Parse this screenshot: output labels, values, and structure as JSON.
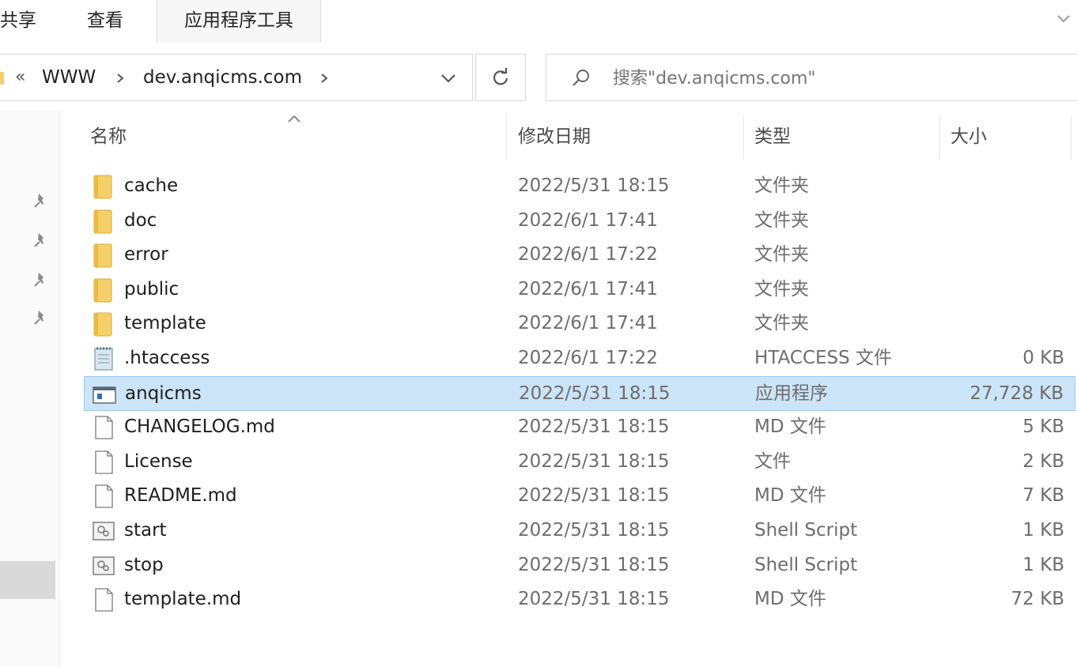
{
  "ribbon": {
    "tabs": [
      {
        "label": "共享"
      },
      {
        "label": "查看"
      },
      {
        "label": "应用程序工具"
      }
    ]
  },
  "address": {
    "overflow": "«",
    "crumbs": [
      "WWW",
      "dev.anqicms.com"
    ],
    "refresh_icon": "refresh-icon",
    "dropdown_icon": "chevron-down-icon"
  },
  "search": {
    "placeholder": "搜索\"dev.anqicms.com\"",
    "icon": "search-icon"
  },
  "columns": {
    "name": "名称",
    "date": "修改日期",
    "type": "类型",
    "size": "大小"
  },
  "files": [
    {
      "name": "cache",
      "date": "2022/5/31 18:15",
      "type": "文件夹",
      "size": "",
      "icon": "folder-icon"
    },
    {
      "name": "doc",
      "date": "2022/6/1 17:41",
      "type": "文件夹",
      "size": "",
      "icon": "folder-icon"
    },
    {
      "name": "error",
      "date": "2022/6/1 17:22",
      "type": "文件夹",
      "size": "",
      "icon": "folder-icon"
    },
    {
      "name": "public",
      "date": "2022/6/1 17:41",
      "type": "文件夹",
      "size": "",
      "icon": "folder-icon"
    },
    {
      "name": "template",
      "date": "2022/6/1 17:41",
      "type": "文件夹",
      "size": "",
      "icon": "folder-icon"
    },
    {
      "name": ".htaccess",
      "date": "2022/6/1 17:22",
      "type": "HTACCESS 文件",
      "size": "0 KB",
      "icon": "notepad-file-icon"
    },
    {
      "name": "anqicms",
      "date": "2022/5/31 18:15",
      "type": "应用程序",
      "size": "27,728 KB",
      "icon": "application-icon",
      "selected": true
    },
    {
      "name": "CHANGELOG.md",
      "date": "2022/5/31 18:15",
      "type": "MD 文件",
      "size": "5 KB",
      "icon": "file-icon"
    },
    {
      "name": "License",
      "date": "2022/5/31 18:15",
      "type": "文件",
      "size": "2 KB",
      "icon": "file-icon"
    },
    {
      "name": "README.md",
      "date": "2022/5/31 18:15",
      "type": "MD 文件",
      "size": "7 KB",
      "icon": "file-icon"
    },
    {
      "name": "start",
      "date": "2022/5/31 18:15",
      "type": "Shell Script",
      "size": "1 KB",
      "icon": "shell-script-icon"
    },
    {
      "name": "stop",
      "date": "2022/5/31 18:15",
      "type": "Shell Script",
      "size": "1 KB",
      "icon": "shell-script-icon"
    },
    {
      "name": "template.md",
      "date": "2022/5/31 18:15",
      "type": "MD 文件",
      "size": "72 KB",
      "icon": "file-icon"
    }
  ],
  "colors": {
    "selection_bg": "#cce4f7",
    "selection_border": "#99c9ef",
    "folder": "#f5cf67"
  }
}
